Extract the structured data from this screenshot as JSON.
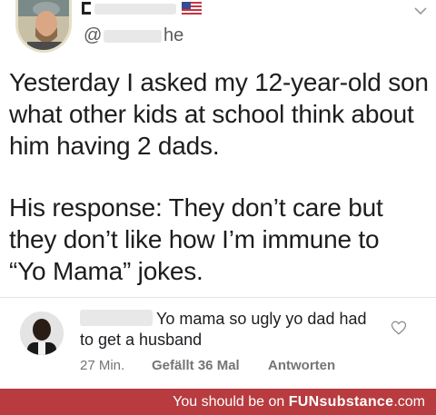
{
  "header": {
    "handle_prefix": "@",
    "handle_suffix": "he",
    "more_icon": "chevron-down-icon",
    "flag_icon": "us-flag-icon"
  },
  "tweet": {
    "lines": [
      "Yesterday I asked my 12-year-old son",
      "what other kids at school think about",
      "him having 2 dads.",
      "His response: They don’t care but",
      "they don’t like how I’m immune to",
      "“Yo Mama” jokes."
    ]
  },
  "comment": {
    "line1": "Yo mama so ugly yo dad had",
    "line2": "to get a husband",
    "time": "27 Min.",
    "likes": "Gefällt 36 Mal",
    "reply": "Antworten",
    "like_icon": "heart-icon"
  },
  "footer": {
    "prefix": "You should be on ",
    "brand": "FUNsubstance",
    "suffix": ".com"
  },
  "colors": {
    "footer_bg": "#b73b3f",
    "text": "#1d1d1d",
    "meta_text": "#757575"
  }
}
